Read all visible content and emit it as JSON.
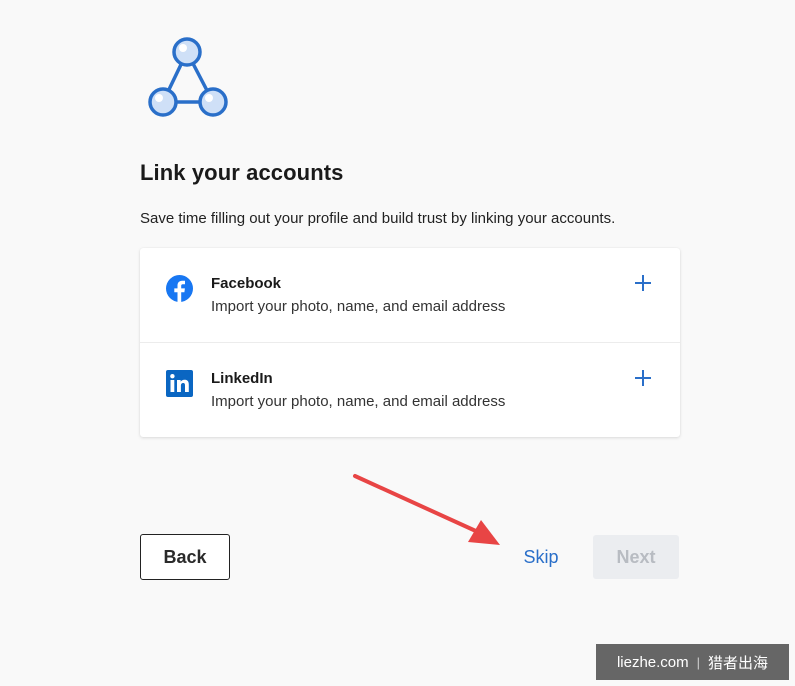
{
  "header": {
    "title": "Link your accounts",
    "subtitle": "Save time filling out your profile and build trust by linking your accounts."
  },
  "accounts": [
    {
      "name": "Facebook",
      "description": "Import your photo, name, and email address",
      "icon": "facebook-icon",
      "action_icon": "plus-icon"
    },
    {
      "name": "LinkedIn",
      "description": "Import your photo, name, and email address",
      "icon": "linkedin-icon",
      "action_icon": "plus-icon"
    }
  ],
  "footer": {
    "back_label": "Back",
    "skip_label": "Skip",
    "next_label": "Next"
  },
  "watermark": {
    "site": "liezhe.com",
    "brand": "猎者出海"
  },
  "colors": {
    "accent": "#2a6fc9",
    "facebook": "#1877f2",
    "linkedin": "#0a66c2",
    "annotation_arrow": "#e84545",
    "disabled_bg": "#ebedf0"
  }
}
